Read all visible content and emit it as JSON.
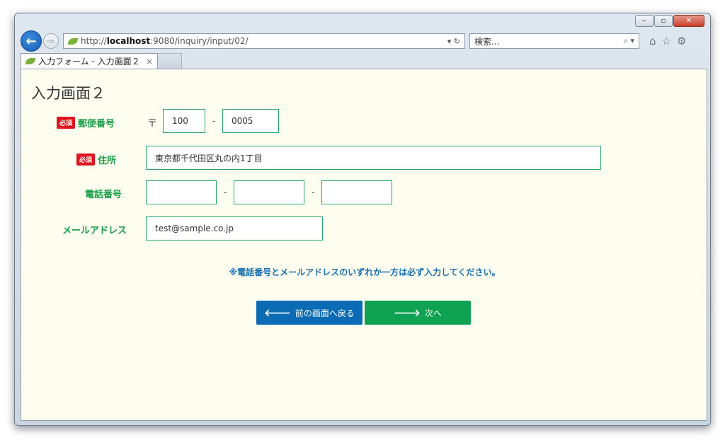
{
  "browser": {
    "address": {
      "url_prefix": "http://",
      "url_host": "localhost",
      "url_rest": ":9080/inquiry/input/02/"
    },
    "search_placeholder": "検索...",
    "tab_title": "入力フォーム - 入力画面２"
  },
  "page": {
    "title": "入力画面２",
    "required_badge": "必須",
    "postal": {
      "label": "郵便番号",
      "mark": "〒",
      "part1": "100",
      "part2": "0005",
      "separator": "-"
    },
    "address": {
      "label": "住所",
      "value": "東京都千代田区丸の内1丁目"
    },
    "phone": {
      "label": "電話番号",
      "part1": "",
      "part2": "",
      "part3": "",
      "separator": "-"
    },
    "email": {
      "label": "メールアドレス",
      "value": "test@sample.co.jp"
    },
    "notice": "※電話番号とメールアドレスのいずれか一方は必ず入力してください。",
    "buttons": {
      "back": "前の画面へ戻る",
      "next": "次へ"
    }
  },
  "colors": {
    "label_green": "#179e47",
    "required_red": "#e0141e",
    "back_blue": "#0b6cb5",
    "next_green": "#0fa252",
    "content_bg": "#fdfdf0"
  },
  "icons": [
    "back-arrow-icon",
    "forward-arrow-icon",
    "leaf-icon",
    "refresh-icon",
    "search-icon",
    "home-icon",
    "star-icon",
    "gear-icon",
    "close-icon",
    "arrow-left-icon",
    "arrow-right-icon"
  ]
}
